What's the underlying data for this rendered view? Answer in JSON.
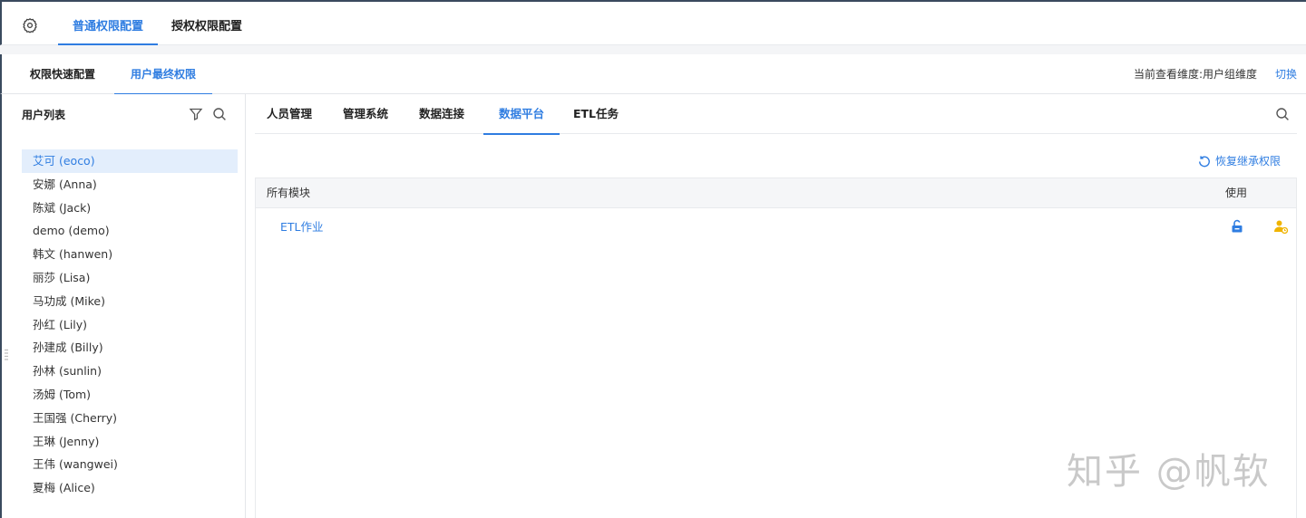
{
  "topbar": {
    "settings_icon": "gear-icon",
    "tabs": [
      {
        "label": "普通权限配置",
        "active": true
      },
      {
        "label": "授权权限配置",
        "active": false
      }
    ]
  },
  "subbar": {
    "tabs": [
      {
        "label": "权限快速配置",
        "active": false
      },
      {
        "label": "用户最终权限",
        "active": true
      }
    ],
    "dimension_text": "当前查看维度:用户组维度",
    "switch_label": "切换"
  },
  "sidebar": {
    "title": "用户列表",
    "icons": [
      "filter-icon",
      "search-icon"
    ],
    "users": [
      {
        "name": "艾可 (eoco)",
        "selected": true
      },
      {
        "name": "安娜 (Anna)"
      },
      {
        "name": "陈斌 (Jack)"
      },
      {
        "name": "demo (demo)"
      },
      {
        "name": "韩文 (hanwen)"
      },
      {
        "name": "丽莎 (Lisa)"
      },
      {
        "name": "马功成 (Mike)"
      },
      {
        "name": "孙红 (Lily)"
      },
      {
        "name": "孙建成 (Billy)"
      },
      {
        "name": "孙林 (sunlin)"
      },
      {
        "name": "汤姆 (Tom)"
      },
      {
        "name": "王国强 (Cherry)"
      },
      {
        "name": "王琳 (Jenny)"
      },
      {
        "name": "王伟 (wangwei)"
      },
      {
        "name": "夏梅 (Alice)"
      }
    ]
  },
  "main": {
    "tabs": [
      {
        "label": "人员管理",
        "active": false
      },
      {
        "label": "管理系统",
        "active": false
      },
      {
        "label": "数据连接",
        "active": false
      },
      {
        "label": "数据平台",
        "active": true
      },
      {
        "label": "ETL任务",
        "active": false
      }
    ],
    "search_icon": "search-icon",
    "restore_label": "恢复继承权限",
    "table": {
      "col_module": "所有模块",
      "col_use": "使用",
      "rows": [
        {
          "module": "ETL作业",
          "icons": [
            "unlock-icon",
            "user-icon"
          ]
        }
      ]
    }
  },
  "watermark": "知乎 @帆软",
  "colors": {
    "accent": "#2f7de1",
    "selected_bg": "#e3eefc",
    "user_icon": "#f0b400"
  }
}
